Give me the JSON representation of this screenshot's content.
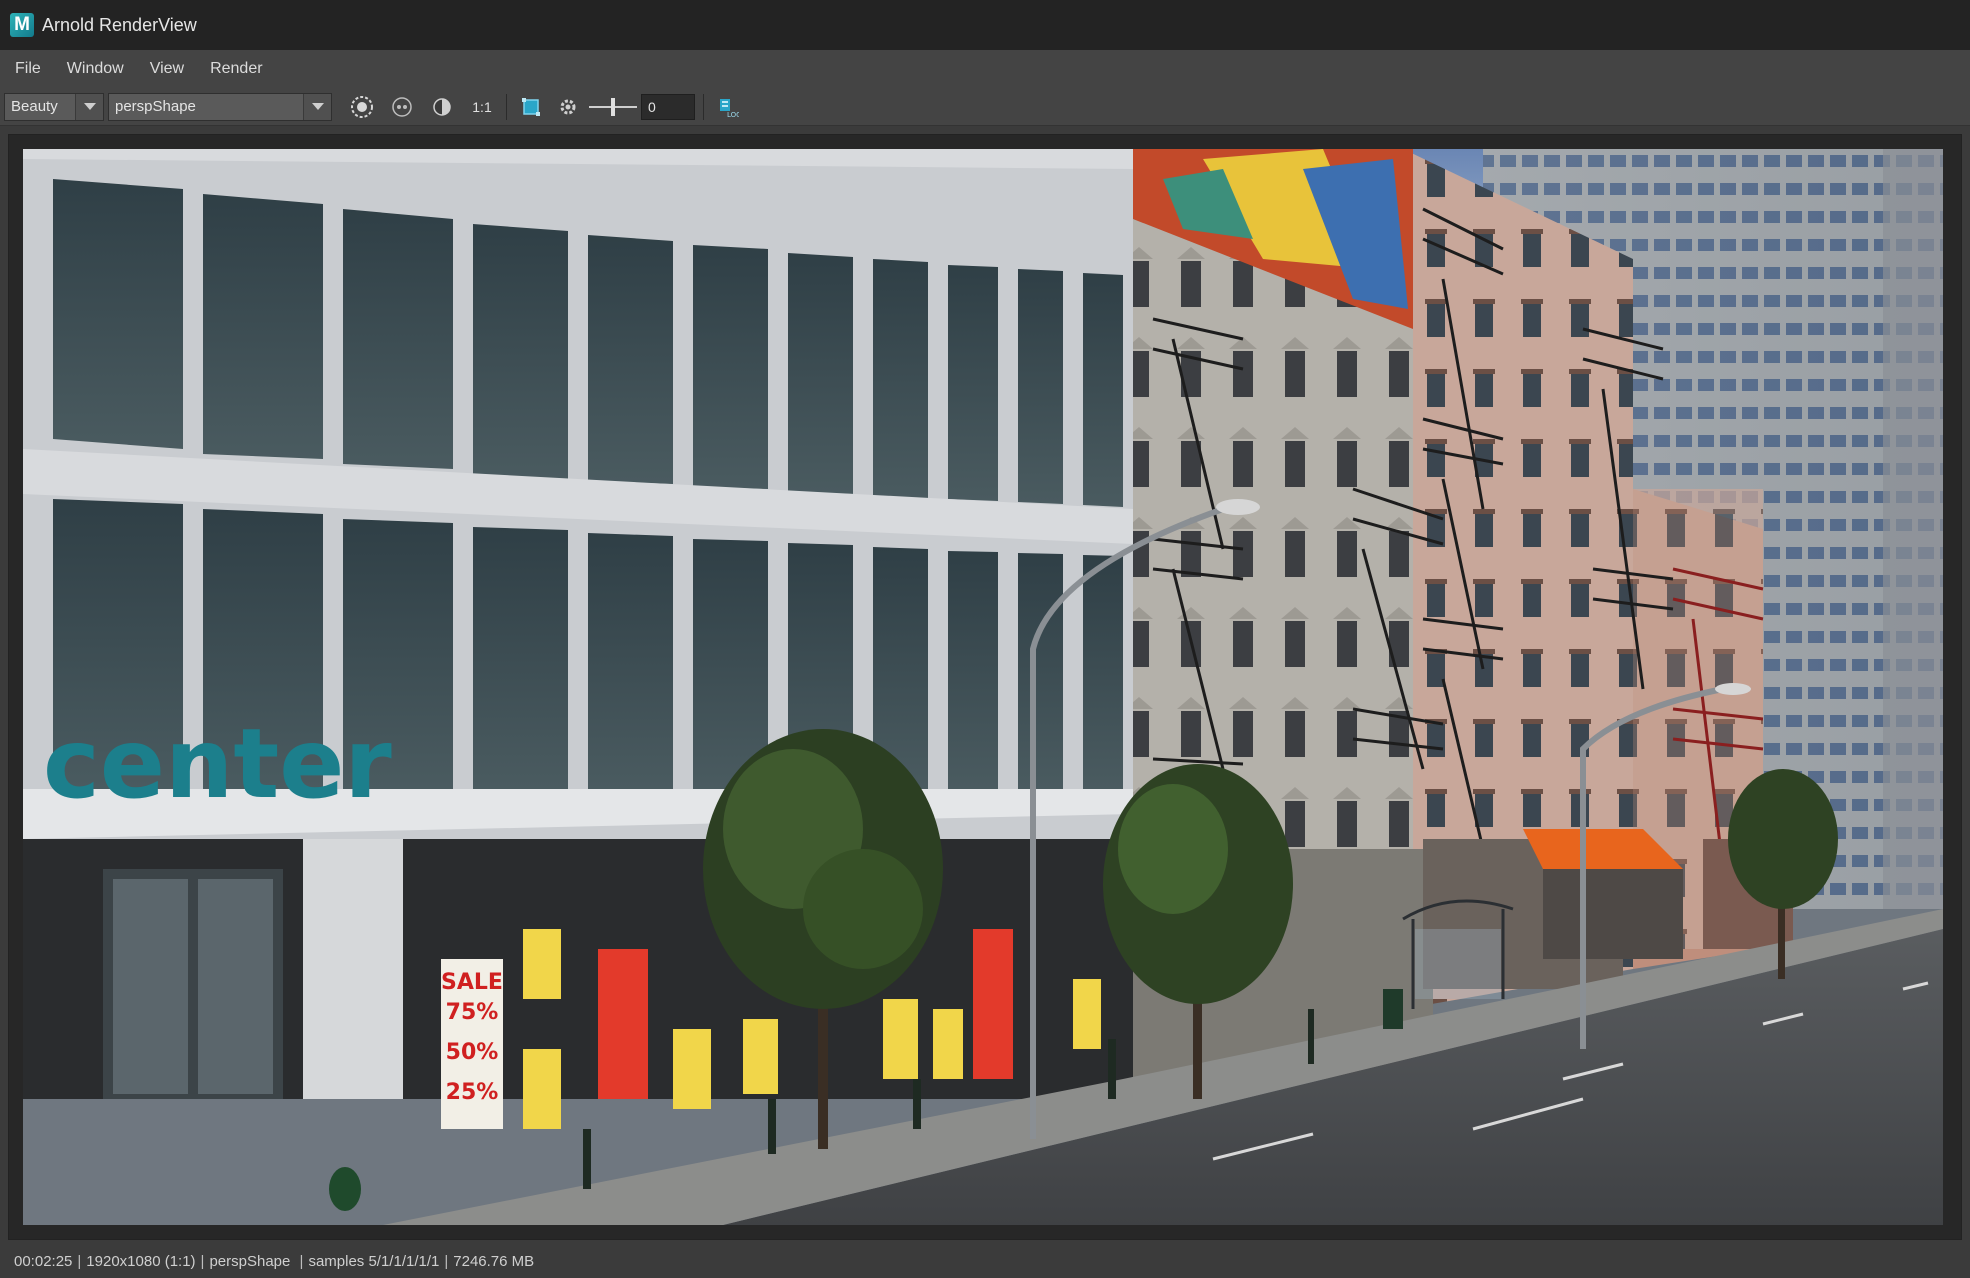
{
  "window": {
    "title": "Arnold RenderView",
    "logo_icon": "maya-logo-icon",
    "logo_letter": "M"
  },
  "menu": {
    "items": [
      "File",
      "Window",
      "View",
      "Render"
    ]
  },
  "toolbar": {
    "aov_value": "Beauty",
    "camera_value": "perspShape",
    "ratio_label": "1:1",
    "exposure_value": "0",
    "icons": [
      "crosshair-ring-icon",
      "rgb-channels-icon",
      "half-circle-icon",
      "region-crop-icon",
      "gear-icon",
      "exposure-slider",
      "log-icon"
    ]
  },
  "render": {
    "sign_text": "center",
    "store_signs": [
      "SALE",
      "75%",
      "50%",
      "25%"
    ],
    "awning_color": "#e8651d"
  },
  "status": {
    "time": "00:02:25",
    "resolution": "1920x1080 (1:1)",
    "camera": "perspShape",
    "samples": "samples 5/1/1/1/1/1",
    "memory": "7246.76 MB"
  },
  "colors": {
    "titlebar_bg": "#232323",
    "menu_bg": "#444444",
    "viewport_bg": "#272727",
    "accent_logo": "#2fb3b8"
  }
}
